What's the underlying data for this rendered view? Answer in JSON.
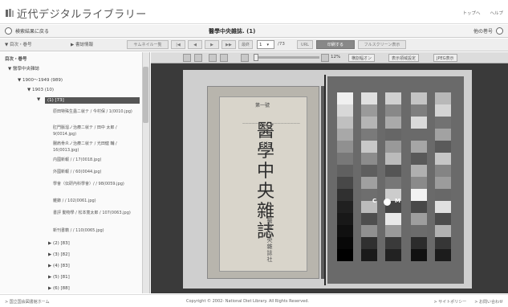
{
  "header": {
    "logo_text": "近代デジタルライブラリー",
    "links": [
      "トップへ",
      "ヘルプ"
    ]
  },
  "titlebar": {
    "back_label": "検索結果に戻る",
    "title": "醫學中央雜誌. (1)",
    "next_label": "他の巻号"
  },
  "toolbar": {
    "tab_toc": "目次・巻号",
    "tab_bib": "書誌情報",
    "thumbnail_label": "サムネイル一覧",
    "btn_left1": "",
    "btn_left2": "",
    "btn_right1": "",
    "last_label": "最終",
    "page_value": "1",
    "page_total": "/73",
    "url_label": "URL",
    "print_label": "印刷する",
    "fullscreen_label": "フルスクリーン表示"
  },
  "sidebar": {
    "heading": "目次・巻号",
    "root": "醫學中央雜誌",
    "range": "1900〜1949 (989)",
    "year": "1903 (10)",
    "selected": "(1) [73]",
    "items": [
      "原田特殊生蟲ニ就テ / 今村保 / 1(0010.jpg)",
      "肛門脈溜ノ治療ニ就テ / 田中 太郎 / 9(0014.jpg)",
      "腸肩骨炎ノ治療ニ就テ / 光田健 輔 / 16(0013.jpg)",
      "内國新報 / / 17(0018.jpg)",
      "外國新報 / / 60(0044.jpg)",
      "學會（伝研內科學會）/ / 98(0059.jpg)",
      "雜錄 / / 102(0061.jpg)",
      "書評 動物學 / 松本寛太郎 / 107(0063.jpg)",
      "新刊書籍 / / 110(0065.jpg)"
    ],
    "more": [
      "(2) [83]",
      "(3) [82]",
      "(4) [83]",
      "(5) [81]",
      "(6) [88]"
    ]
  },
  "viewer": {
    "zoom": "12%",
    "page_fit_label": "横割幅オン",
    "display_label": "表示領域設定",
    "jpeg_label": "JPEG表示",
    "cover_title": "醫學中央雜誌",
    "cover_publisher": "醫學中央雜誌社",
    "cover_top": "第一號"
  },
  "footer": {
    "left": "> 国立国会図書館ホーム",
    "center": "Copyright © 2002- National Diet Library. All Rights Reserved.",
    "links": [
      "> サイトポリシー",
      "> お問い合わせ"
    ]
  },
  "colors": {
    "viewer_bg": "#3a3a3a",
    "selected_bg": "#555555",
    "cover": "#d9d5cb"
  }
}
